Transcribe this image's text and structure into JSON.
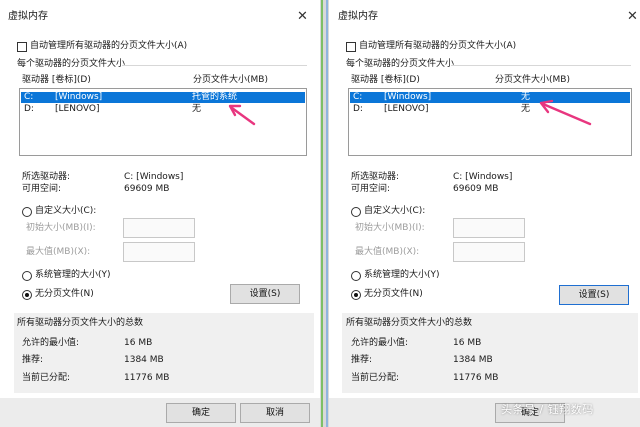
{
  "left": {
    "title": "虚拟内存",
    "auto_manage_label": "自动管理所有驱动器的分页文件大小(A)",
    "group_label": "每个驱动器的分页文件大小",
    "col_drive": "驱动器 [卷标](D)",
    "col_size": "分页文件大小(MB)",
    "drives": [
      {
        "letter": "C:",
        "label": "[Windows]",
        "size": "托管的系统"
      },
      {
        "letter": "D:",
        "label": "[LENOVO]",
        "size": "无"
      }
    ],
    "selected_drive_label": "所选驱动器:",
    "selected_drive_value": "C:  [Windows]",
    "free_space_label": "可用空间:",
    "free_space_value": "69609 MB",
    "custom_size_label": "自定义大小(C):",
    "initial_size_label": "初始大小(MB)(I):",
    "max_size_label": "最大值(MB)(X):",
    "system_managed_label": "系统管理的大小(Y)",
    "no_paging_label": "无分页文件(N)",
    "set_button": "设置(S)",
    "totals_label": "所有驱动器分页文件大小的总数",
    "min_allowed_label": "允许的最小值:",
    "min_allowed_value": "16 MB",
    "recommended_label": "推荐:",
    "recommended_value": "1384 MB",
    "current_alloc_label": "当前已分配:",
    "current_alloc_value": "11776 MB",
    "ok_button": "确定",
    "cancel_button": "取消"
  },
  "right": {
    "title": "虚拟内存",
    "auto_manage_label": "自动管理所有驱动器的分页文件大小(A)",
    "group_label": "每个驱动器的分页文件大小",
    "col_drive": "驱动器 [卷标](D)",
    "col_size": "分页文件大小(MB)",
    "drives": [
      {
        "letter": "C:",
        "label": "[Windows]",
        "size": "无"
      },
      {
        "letter": "D:",
        "label": "[LENOVO]",
        "size": "无"
      }
    ],
    "selected_drive_label": "所选驱动器:",
    "selected_drive_value": "C:  [Windows]",
    "free_space_label": "可用空间:",
    "free_space_value": "69609 MB",
    "custom_size_label": "自定义大小(C):",
    "initial_size_label": "初始大小(MB)(I):",
    "max_size_label": "最大值(MB)(X):",
    "system_managed_label": "系统管理的大小(Y)",
    "no_paging_label": "无分页文件(N)",
    "set_button": "设置(S)",
    "totals_label": "所有驱动器分页文件大小的总数",
    "min_allowed_label": "允许的最小值:",
    "min_allowed_value": "16 MB",
    "recommended_label": "推荐:",
    "recommended_value": "1384 MB",
    "current_alloc_label": "当前已分配:",
    "current_alloc_value": "11776 MB",
    "ok_button": "确定",
    "watermark": "头条号 / 钰翔数码"
  },
  "colors": {
    "selection": "#0b76d8",
    "arrow": "#e8367f",
    "focus_border": "#1f6fd1"
  },
  "icons": [
    "close-icon",
    "annotation-arrow-icon"
  ]
}
